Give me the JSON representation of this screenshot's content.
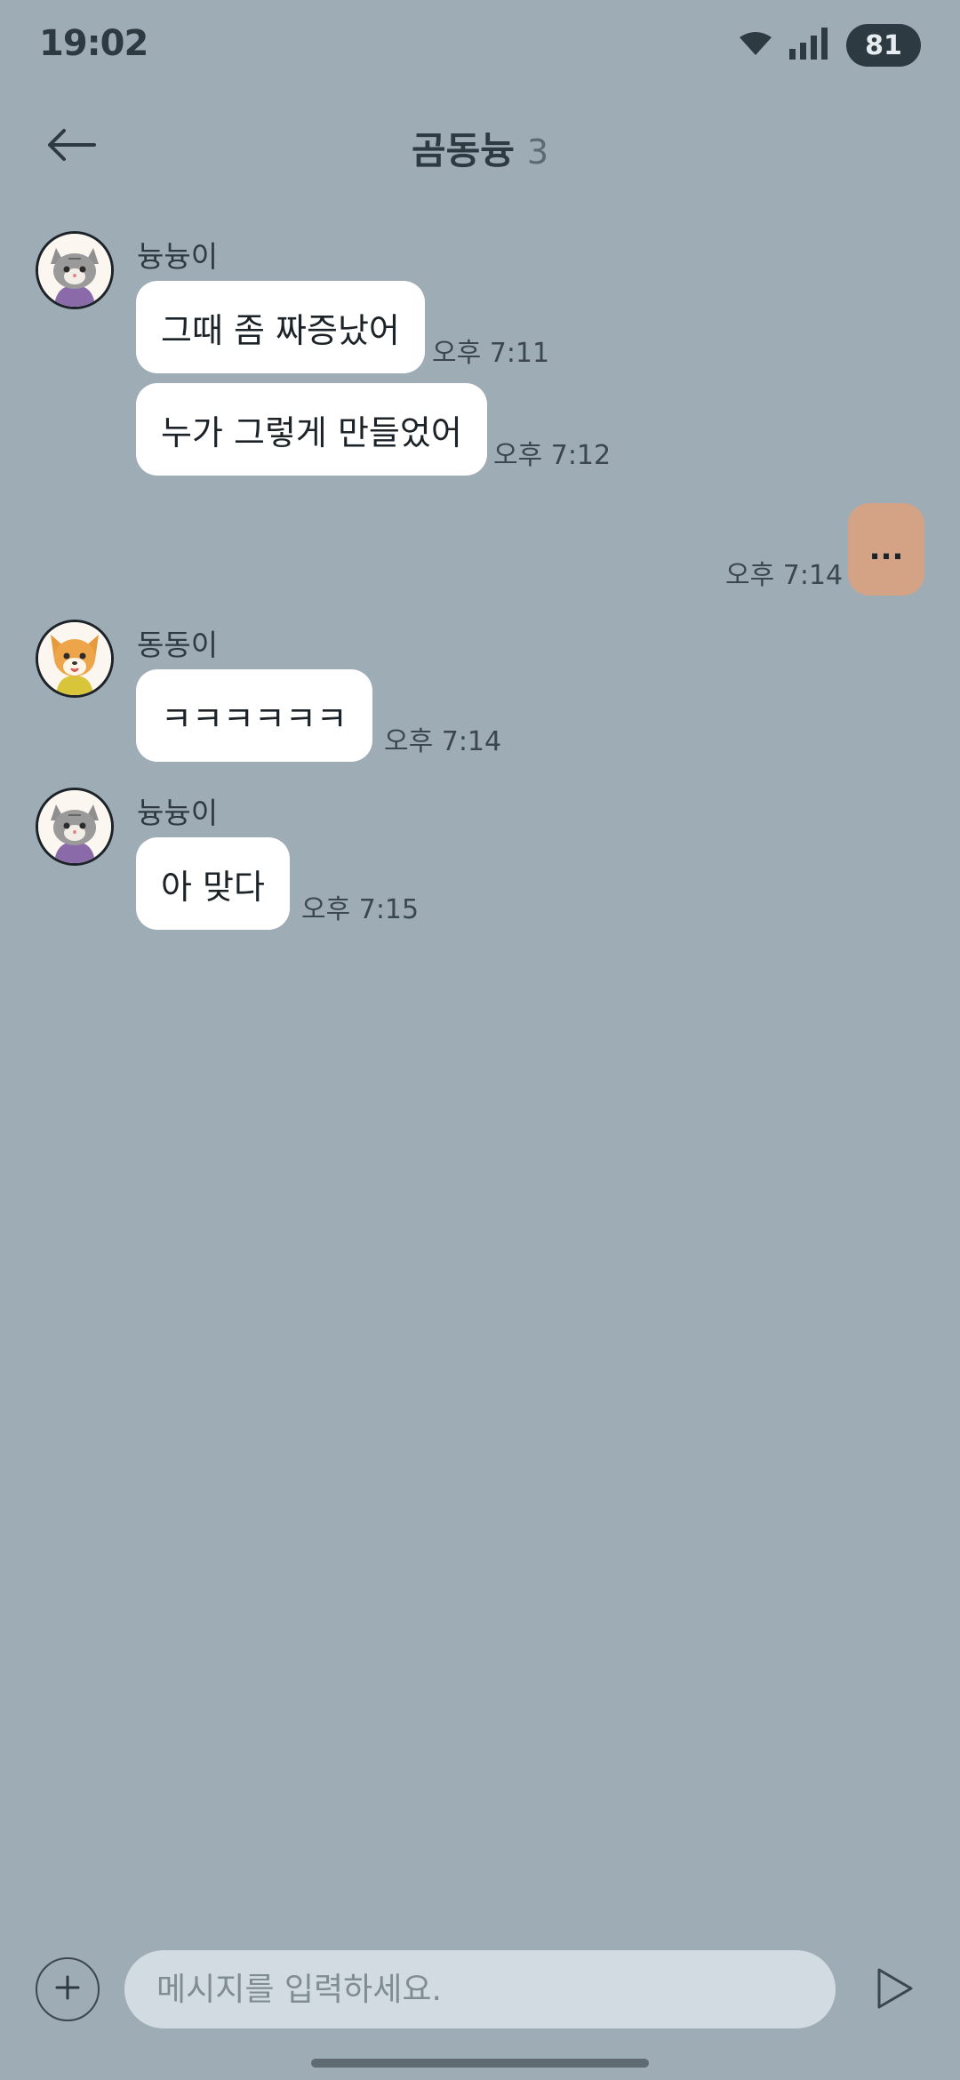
{
  "status_bar": {
    "time": "19:02",
    "battery": "81"
  },
  "header": {
    "title": "곰동늉",
    "member_count": "3"
  },
  "messages": [
    {
      "sender": "늉늉이",
      "avatar": "cat-avatar-icon",
      "text": "그때 좀 짜증났어",
      "time": "오후 7:11"
    },
    {
      "sender": "늉늉이",
      "text": "누가 그렇게 만들었어",
      "time": "오후 7:12"
    },
    {
      "sender": "me",
      "text": "...",
      "time": "오후 7:14"
    },
    {
      "sender": "동동이",
      "avatar": "dog-avatar-icon",
      "text": "ㅋㅋㅋㅋㅋㅋ",
      "time": "오후 7:14"
    },
    {
      "sender": "늉늉이",
      "avatar": "cat-avatar-icon",
      "text": "아 맞다",
      "time": "오후 7:15"
    }
  ],
  "composer": {
    "placeholder": "메시지를 입력하세요."
  },
  "colors": {
    "background": "#9eacb5",
    "my_bubble": "#d4a386",
    "other_bubble": "#ffffff",
    "input_bg": "#d2dbe1"
  }
}
